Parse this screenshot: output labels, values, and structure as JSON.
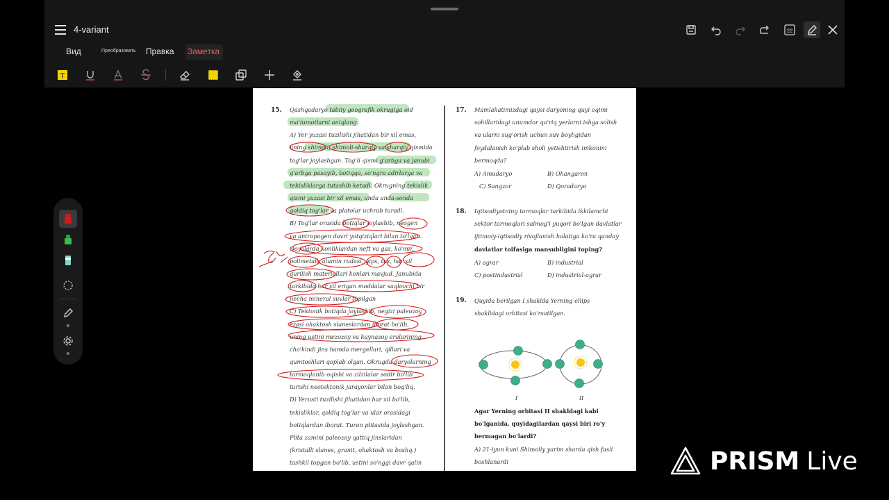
{
  "window": {
    "title": "4-variant"
  },
  "menu": {
    "items": [
      "Вид",
      "Преобразовать",
      "Правка",
      "Заметка"
    ],
    "active": "Заметка"
  },
  "toolbar": {
    "page_badge": "22"
  },
  "colors": {
    "accent": "#e56060",
    "highlight": "#8cd28c",
    "ink": "#d11a1a",
    "panel": "#161616"
  },
  "icons": {
    "title_bar": [
      "save-icon",
      "undo-icon",
      "redo-icon",
      "share-icon",
      "page-badge-icon",
      "edit-icon",
      "close-icon"
    ],
    "annotation_tools": [
      "highlighter-icon",
      "underline-icon",
      "text-color-icon",
      "strikethrough-icon",
      "eraser-icon",
      "area-highlight-icon",
      "shapes-icon",
      "add-icon",
      "signature-icon"
    ],
    "side_tools": [
      "red-pen-icon",
      "green-pen-icon",
      "teal-pen-icon",
      "lasso-icon",
      "pencil-icon",
      "settings-icon"
    ]
  },
  "document": {
    "left_column": {
      "q15": {
        "number": "15.",
        "lines": [
          "Qashqadaryo tabiiy geografik okrugiga oid",
          "ma'lumotlarni aniqlang.",
          "A) Yer yuzasi tuzilishi jihatidan bir xil emas,",
          "uning shimoli, shimoli-sharqiy va sharqiy qismida",
          "tog'lar joylashgan. Tog'li qismi g'arbga va janubi",
          "g'arbga pasayib, botiqqa, so'ngra adirlarga va",
          "tekisliklarga tutashib ketadi. Okrugning tekislik",
          "qismi yuzasi bir xil emas, unda anda-sonda",
          "qoldiq tog'lar va platolar uchrab turadi.",
          "B) Tog'lar orasida botiqlar joylashib, neogen",
          "va antropogen davri yotqiziqlari bilan to'lgan.",
          "Qoyalarda konliklardan neft va gaz, ko'mir,",
          "polimetall, alumin rudasi, gips, tuz, har xil",
          "qurilish materiallari konlari mavjud. Janubida",
          "tarkibida har xil erigan moddalar saqlovchi bir",
          "necha mineral suvlar topilgan",
          "C) Tektonik botiqda joylashib, negizi paleozoy",
          "erasi ohaktosh slaneslardan iborat bo'lib,",
          "uning ustini mezozoy va kaynazoy eralarining",
          "cho'kindi jins hamda mergellari, qillari va",
          "qumtoshlari qoplab olgan. Okrugda daryolarning",
          "tarmoqlanib oqishi va zilzilalar sodir bo'lib",
          "turishi neotektonik jarayonlar bilan bog'liq.",
          "D) Yerusti tuzilishi jihatidan har xil bo'lib,",
          "tekisliklar, qoldiq tog'lar va ular orasidagi",
          "botiqlardan iborat. Turon plitasida joylashgan.",
          "Plita zamini paleozoy qattiq jinslaridan",
          "(kristalli slanes, granit, ohaktosh va boshq.)",
          "tashkil topgan bo'lib, ustini so'nggi davr qalin"
        ]
      }
    },
    "right_column": {
      "q17": {
        "number": "17.",
        "lines": [
          "Mamlakatimizdagi qaysi daryoning quyi oqimi",
          "sohillaridagi unumdor qo'riq yerlarni ishga solish",
          "va ularni sug'orish uchun suv boyligidan",
          "foydalanish ko'plab sholi yetishtirish imkonini",
          "bermoqda?"
        ],
        "options": [
          "A) Amudaryo",
          "B) Ohangaron",
          "C) Sangzor",
          "D) Qoradaryo"
        ]
      },
      "q18": {
        "number": "18.",
        "lines": [
          "Iqtisodiyotning tarmoqlar tarkibida ikkilamchi",
          "sektor tarmoqlari salmog'i yuqori bo'lgan davlatlar",
          "ijtimoiy-iqtisodiy rivojlanish holatiga ko'ra qanday",
          "davlatlar toifasiga mansubligini toping?"
        ],
        "options": [
          "A) agrar",
          "B) industrial",
          "C) postindustrial",
          "D) industrial-agrar"
        ]
      },
      "q19": {
        "number": "19.",
        "lines": [
          "Quyida berilgan I shaklda Yerning ellips",
          "shaklidagi orbitasi ko'rsatilgan."
        ],
        "figure_labels": [
          "I",
          "II"
        ],
        "question_lines": [
          "Agar Yerning orbitasi II shakldagi kabi",
          "bo'lganida, quyidagilardan qaysi biri ro'y",
          "bermagan bo'lardi?"
        ],
        "option_lines": [
          "A) 21-iyun kuni Shimoliy yarim sharda qish fasli",
          "boshlanardi"
        ]
      }
    }
  },
  "watermark": {
    "brand": "PRISM",
    "suffix": "Live"
  }
}
